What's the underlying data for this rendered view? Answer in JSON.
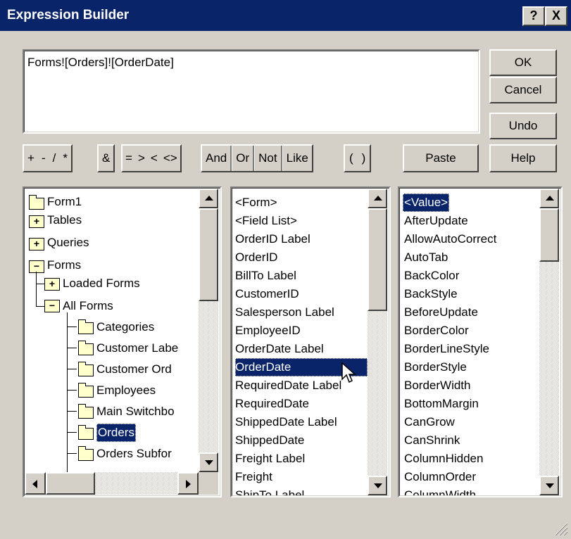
{
  "window": {
    "title": "Expression Builder"
  },
  "title_buttons": {
    "help": "?",
    "close": "X"
  },
  "expression": {
    "value": "Forms![Orders]![OrderDate]"
  },
  "buttons": {
    "ok": "OK",
    "cancel": "Cancel",
    "undo": "Undo",
    "paste": "Paste",
    "help": "Help"
  },
  "operators": {
    "group1": [
      "+",
      "-",
      "/",
      "*"
    ],
    "group2": [
      "&"
    ],
    "group3": [
      "=",
      ">",
      "<",
      "<>"
    ],
    "group4": [
      "And"
    ],
    "group5": [
      "Or"
    ],
    "group6": [
      "Not"
    ],
    "group7": [
      "Like"
    ],
    "group8": [
      "(",
      ")"
    ]
  },
  "tree": {
    "items": [
      {
        "label": "Form1"
      },
      {
        "label": "Tables"
      },
      {
        "label": "Queries"
      },
      {
        "label": "Forms"
      },
      {
        "label": "Loaded Forms"
      },
      {
        "label": "All Forms"
      },
      {
        "label": "Categories"
      },
      {
        "label": "Customer Labe"
      },
      {
        "label": "Customer Ord"
      },
      {
        "label": "Employees"
      },
      {
        "label": "Main Switchbo"
      },
      {
        "label": "Orders",
        "selected": true
      },
      {
        "label": "Orders Subfor"
      }
    ]
  },
  "fields": {
    "items": [
      "<Form>",
      "<Field List>",
      "OrderID Label",
      "OrderID",
      "BillTo Label",
      "CustomerID",
      "Salesperson Label",
      "EmployeeID",
      "OrderDate Label",
      "OrderDate",
      "RequiredDate Label",
      "RequiredDate",
      "ShippedDate Label",
      "ShippedDate",
      "Freight Label",
      "Freight",
      "ShipTo Label"
    ],
    "selected": "OrderDate"
  },
  "properties": {
    "items": [
      "<Value>",
      "AfterUpdate",
      "AllowAutoCorrect",
      "AutoTab",
      "BackColor",
      "BackStyle",
      "BeforeUpdate",
      "BorderColor",
      "BorderLineStyle",
      "BorderStyle",
      "BorderWidth",
      "BottomMargin",
      "CanGrow",
      "CanShrink",
      "ColumnHidden",
      "ColumnOrder",
      "ColumnWidth"
    ],
    "selected": "<Value>"
  },
  "colors": {
    "title_bar": "#0a246a",
    "face": "#d4d0c8",
    "selection": "#0a246a"
  }
}
